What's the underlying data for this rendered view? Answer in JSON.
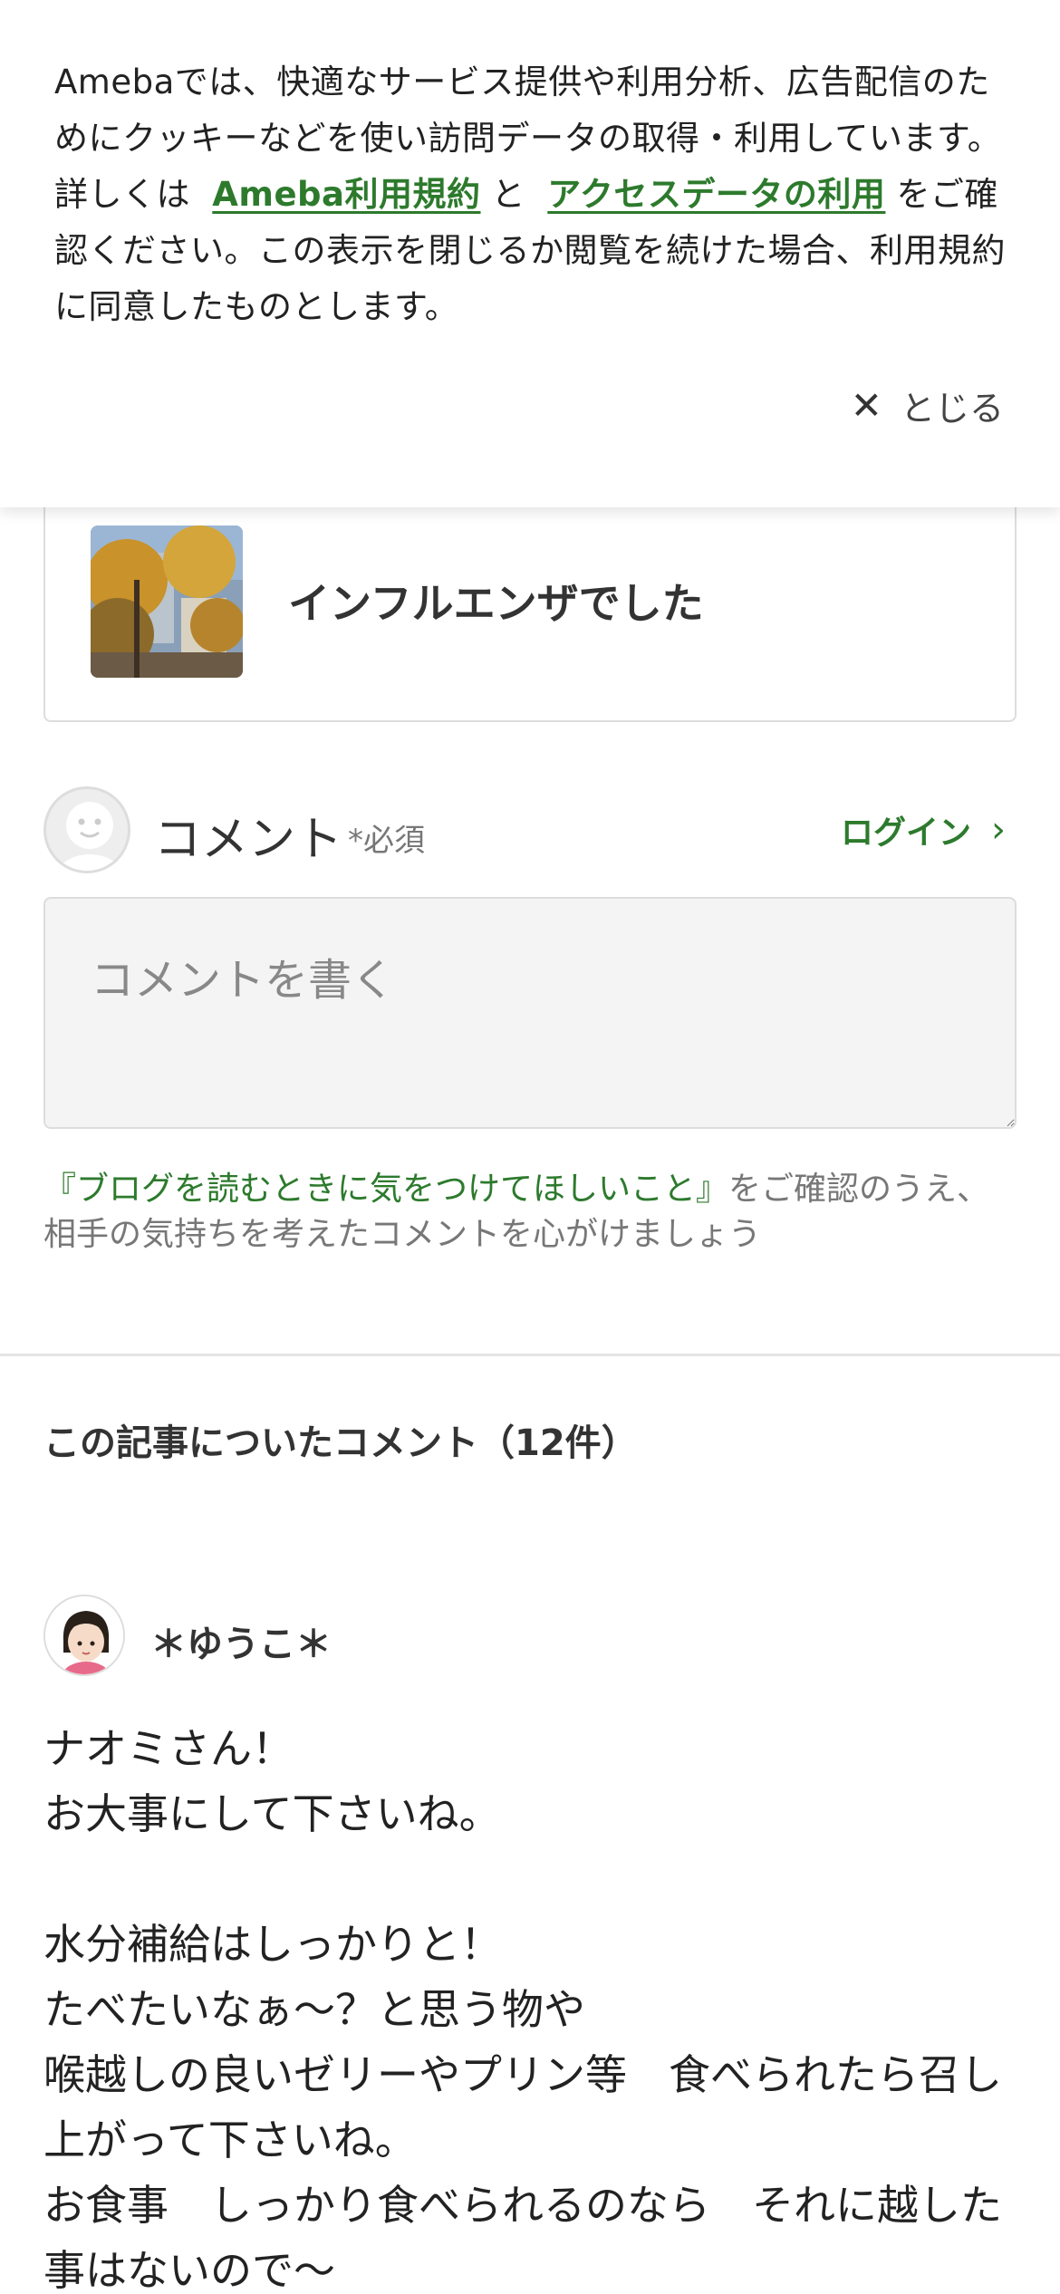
{
  "cookie_banner": {
    "text_before": "Amebaでは、快適なサービス提供や利用分析、広告配信のためにクッキーなどを使い訪問データの取得・利用しています。詳しくは",
    "terms_link": "Ameba利用規約",
    "conjunction": "と",
    "access_link": "アクセスデータの利用",
    "text_after": "をご確認ください。この表示を閉じるか閲覧を続けた場合、利用規約に同意したものとします。",
    "close_label": "とじる"
  },
  "article": {
    "title": "インフルエンザでした"
  },
  "comment_form": {
    "label": "コメント",
    "required": "*必須",
    "login": "ログイン",
    "placeholder": "コメントを書く",
    "guideline_link": "『ブログを読むときに気をつけてほしいこと』",
    "guideline_text": "をご確認のうえ、相手の気持ちを考えたコメントを心がけましょう"
  },
  "comments": {
    "title": "この記事についたコメント（12件）",
    "items": [
      {
        "author": "＊ゆうこ＊",
        "body": "ナオミさん！\nお大事にして下さいね。\n\n水分補給はしっかりと！\nたべたいなぁ〜？と思う物や\n喉越しの良いゼリーやプリン等　食べられたら召し上がって下さいね。\nお食事　しっかり食べられるのなら　それに越した事はないので〜"
      }
    ]
  },
  "colors": {
    "accent": "#2d7a2d",
    "text": "#333333",
    "muted": "#777777"
  }
}
